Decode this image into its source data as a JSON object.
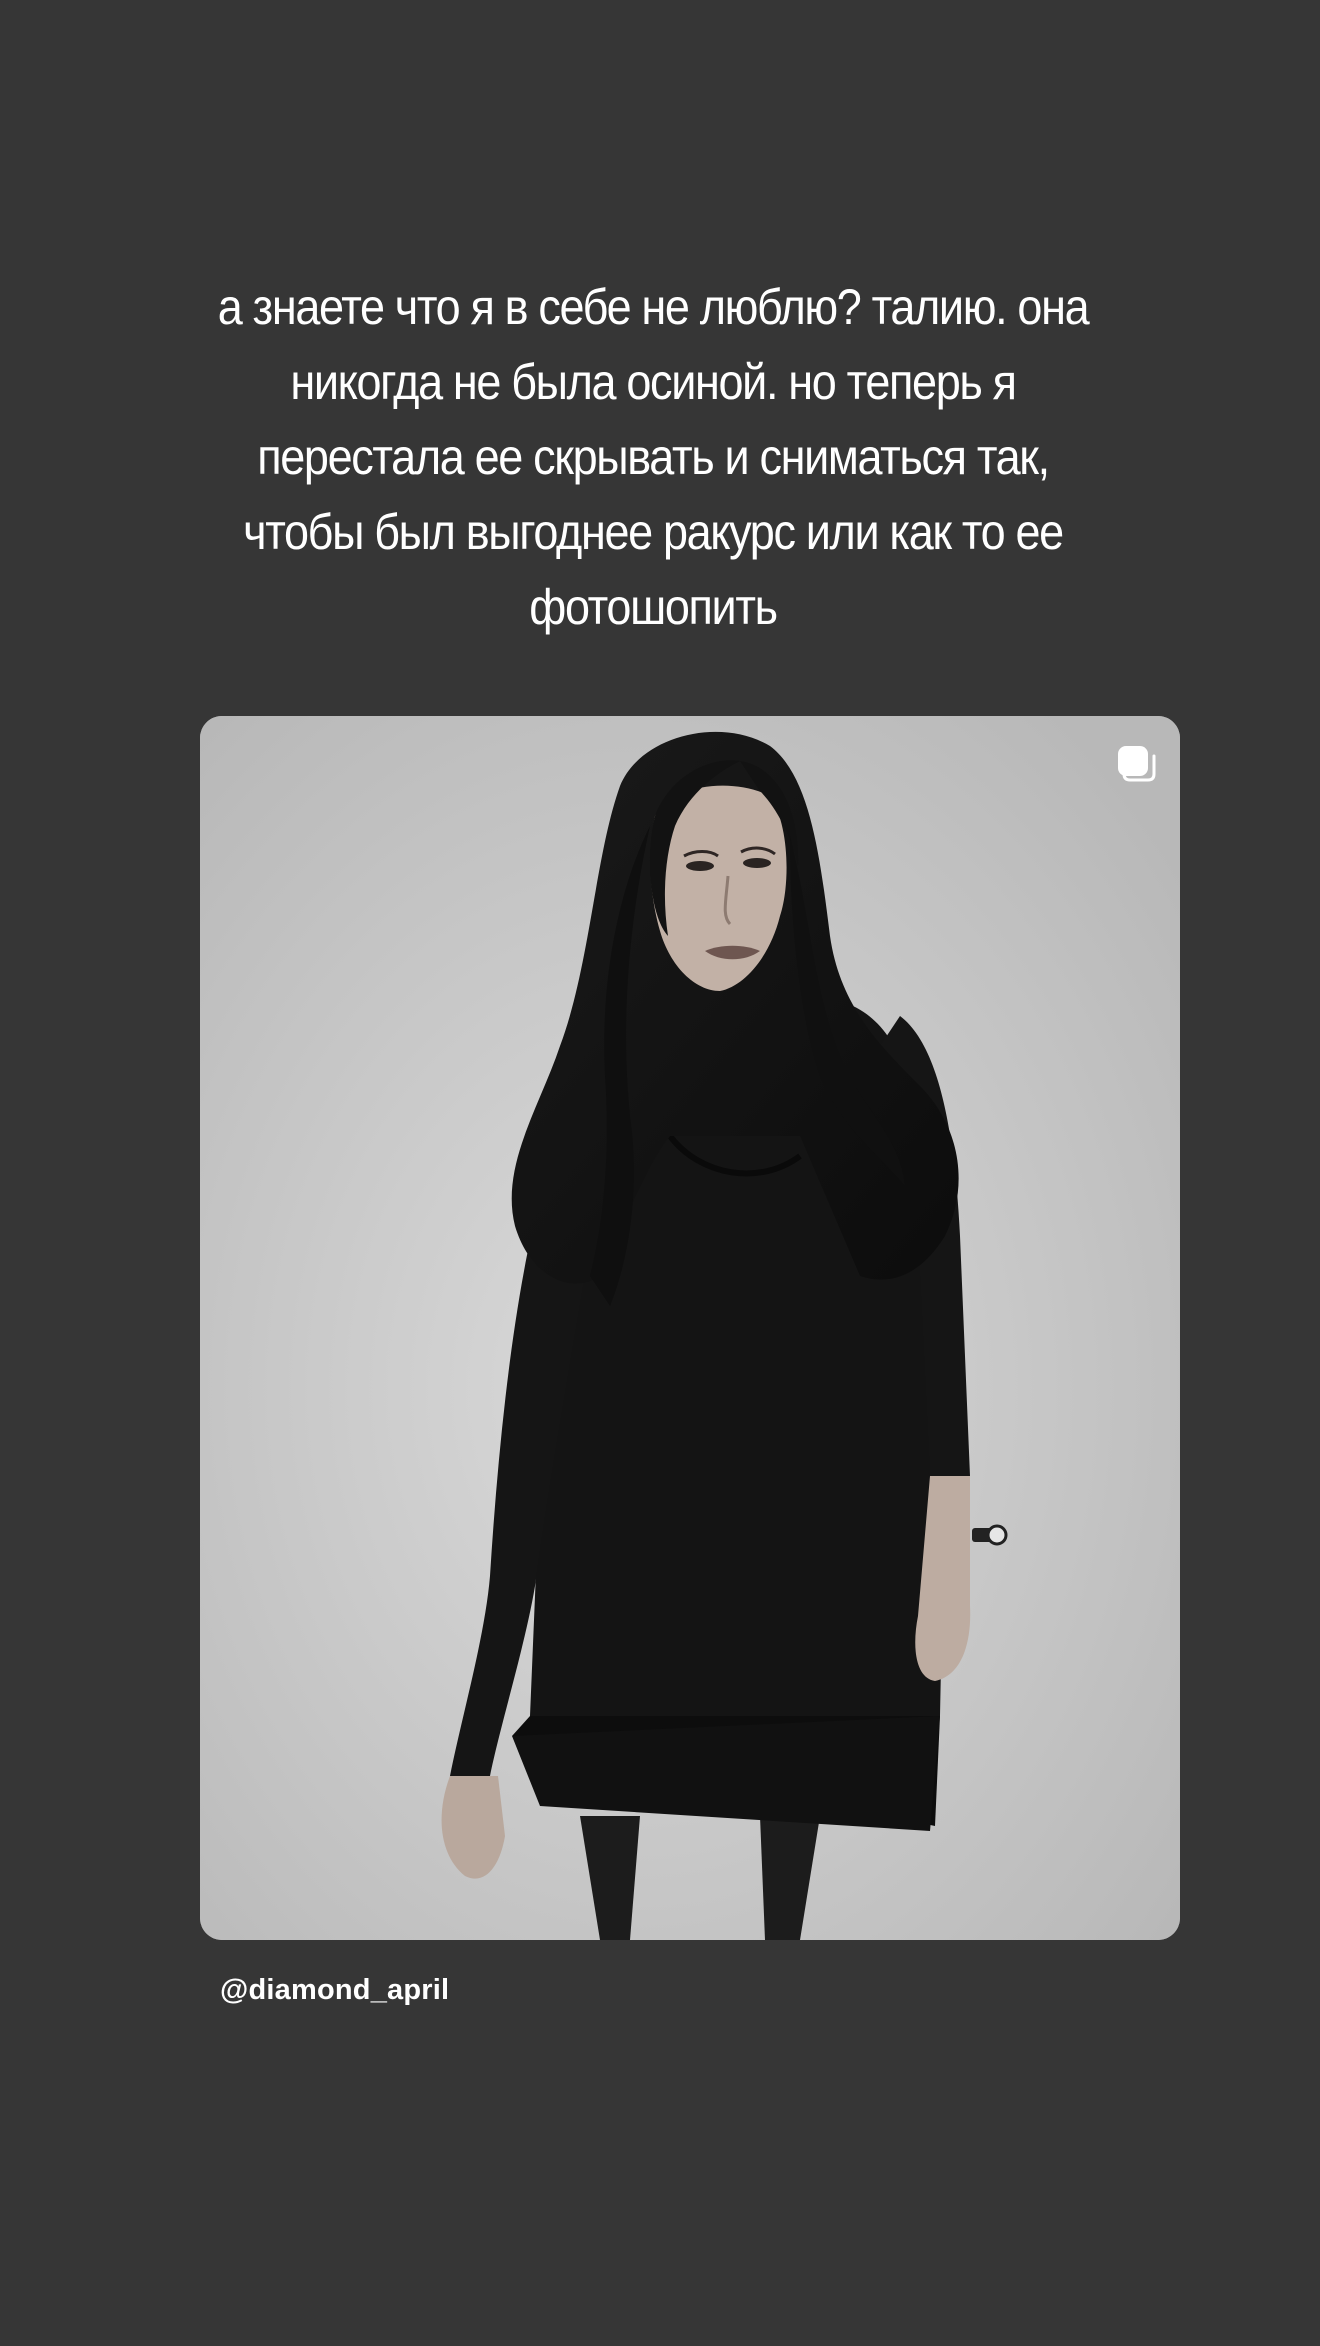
{
  "story": {
    "text_lines": [
      "а знаете что я в себе не люблю? талию. она",
      "никогда не была осиной. но теперь я",
      "перестала ее скрывать и сниматься так,",
      "чтобы был выгоднее ракурс или как то ее",
      "фотошопить"
    ],
    "mention": "@diamond_april"
  },
  "photo": {
    "style": "black-and-white portrait",
    "icon": "multiple-posts-icon"
  },
  "colors": {
    "background": "#363636",
    "text": "#ffffff"
  }
}
